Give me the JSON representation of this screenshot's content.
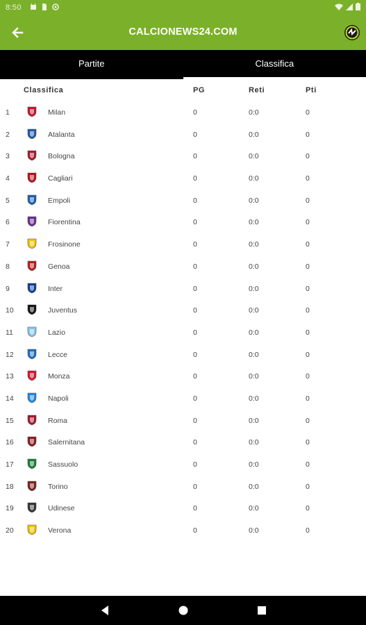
{
  "status_bar": {
    "time": "8:50",
    "icons": [
      "calendar-icon",
      "sim-icon",
      "at-icon"
    ],
    "right_icons": [
      "wifi-icon",
      "signal-icon",
      "battery-icon"
    ]
  },
  "app_bar": {
    "title": "CALCIONEWS24.COM",
    "back_icon": "arrow-back-icon",
    "logo_icon": "calcionews-logo-icon"
  },
  "tabs": [
    {
      "label": "Partite",
      "active": false
    },
    {
      "label": "Classifica",
      "active": true
    }
  ],
  "table": {
    "headers": {
      "team": "Classifica",
      "pg": "PG",
      "reti": "Reti",
      "pti": "Pti"
    },
    "rows": [
      {
        "pos": "1",
        "team": "Milan",
        "pg": "0",
        "reti": "0:0",
        "pti": "0",
        "color": "#c8102e"
      },
      {
        "pos": "2",
        "team": "Atalanta",
        "pg": "0",
        "reti": "0:0",
        "pti": "0",
        "color": "#1e5aa8"
      },
      {
        "pos": "3",
        "team": "Bologna",
        "pg": "0",
        "reti": "0:0",
        "pti": "0",
        "color": "#a6192e"
      },
      {
        "pos": "4",
        "team": "Cagliari",
        "pg": "0",
        "reti": "0:0",
        "pti": "0",
        "color": "#b5121b"
      },
      {
        "pos": "5",
        "team": "Empoli",
        "pg": "0",
        "reti": "0:0",
        "pti": "0",
        "color": "#1b5fb0"
      },
      {
        "pos": "6",
        "team": "Fiorentina",
        "pg": "0",
        "reti": "0:0",
        "pti": "0",
        "color": "#6a2c91"
      },
      {
        "pos": "7",
        "team": "Frosinone",
        "pg": "0",
        "reti": "0:0",
        "pti": "0",
        "color": "#f2c200"
      },
      {
        "pos": "8",
        "team": "Genoa",
        "pg": "0",
        "reti": "0:0",
        "pti": "0",
        "color": "#b71c1c"
      },
      {
        "pos": "9",
        "team": "Inter",
        "pg": "0",
        "reti": "0:0",
        "pti": "0",
        "color": "#0a3f8f"
      },
      {
        "pos": "10",
        "team": "Juventus",
        "pg": "0",
        "reti": "0:0",
        "pti": "0",
        "color": "#111111"
      },
      {
        "pos": "11",
        "team": "Lazio",
        "pg": "0",
        "reti": "0:0",
        "pti": "0",
        "color": "#87c5e9"
      },
      {
        "pos": "12",
        "team": "Lecce",
        "pg": "0",
        "reti": "0:0",
        "pti": "0",
        "color": "#1a6fbf"
      },
      {
        "pos": "13",
        "team": "Monza",
        "pg": "0",
        "reti": "0:0",
        "pti": "0",
        "color": "#d7142a"
      },
      {
        "pos": "14",
        "team": "Napoli",
        "pg": "0",
        "reti": "0:0",
        "pti": "0",
        "color": "#1e88e5"
      },
      {
        "pos": "15",
        "team": "Roma",
        "pg": "0",
        "reti": "0:0",
        "pti": "0",
        "color": "#a0172a"
      },
      {
        "pos": "16",
        "team": "Salernitana",
        "pg": "0",
        "reti": "0:0",
        "pti": "0",
        "color": "#8b1a1a"
      },
      {
        "pos": "17",
        "team": "Sassuolo",
        "pg": "0",
        "reti": "0:0",
        "pti": "0",
        "color": "#1b7a3a"
      },
      {
        "pos": "18",
        "team": "Torino",
        "pg": "0",
        "reti": "0:0",
        "pti": "0",
        "color": "#7b1f1f"
      },
      {
        "pos": "19",
        "team": "Udinese",
        "pg": "0",
        "reti": "0:0",
        "pti": "0",
        "color": "#333333"
      },
      {
        "pos": "20",
        "team": "Verona",
        "pg": "0",
        "reti": "0:0",
        "pti": "0",
        "color": "#f2c200"
      }
    ]
  },
  "nav_bar": {
    "icons": [
      "back-triangle-icon",
      "home-circle-icon",
      "recents-square-icon"
    ]
  },
  "colors": {
    "accent": "#7bb12a",
    "tabbar": "#000000",
    "navbar": "#000000"
  }
}
